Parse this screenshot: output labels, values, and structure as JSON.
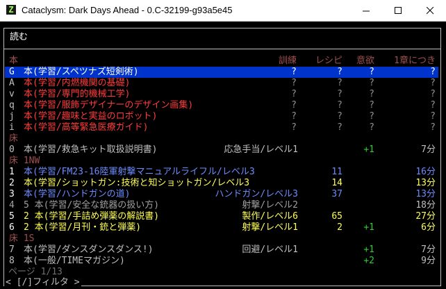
{
  "window": {
    "title": "Cataclysm: Dark Days Ahead - 0.C-32199-g93a5e45",
    "app_icon_glyph": "Z",
    "controls": [
      "minimize-icon",
      "maximize-icon",
      "close-icon"
    ]
  },
  "header": {
    "title": "読む"
  },
  "columns": {
    "section": "本",
    "train": "訓練",
    "recipe": "レシピ",
    "morale": "意欲",
    "per_chapter": "1章につき"
  },
  "groups": [
    {
      "label": "床"
    },
    {
      "label": "床 1NW"
    },
    {
      "label": "床 1S"
    }
  ],
  "rows": [
    {
      "key": "G",
      "name": "本(学習/スペツナズ短剣術)",
      "skill": "",
      "train": "?",
      "recipe": "?",
      "morale": "?",
      "time": "?",
      "color": "#ff3b3b",
      "key_color": "#ffffff",
      "highlight": true
    },
    {
      "key": "A",
      "name": "本(学習/内燃機関の基礎)",
      "skill": "",
      "train": "?",
      "recipe": "?",
      "morale": "?",
      "time": "?",
      "color": "#ff3b3b",
      "key_color": "#c0c0c0"
    },
    {
      "key": "v",
      "name": "本(学習/専門的機械工学)",
      "skill": "",
      "train": "?",
      "recipe": "?",
      "morale": "?",
      "time": "?",
      "color": "#ff3b3b",
      "key_color": "#c0c0c0"
    },
    {
      "key": "q",
      "name": "本(学習/服飾デザイナーのデザイン画集)",
      "skill": "",
      "train": "?",
      "recipe": "?",
      "morale": "?",
      "time": "?",
      "color": "#ff3b3b",
      "key_color": "#c0c0c0"
    },
    {
      "key": "j",
      "name": "本(学習/趣味と実益のロボット)",
      "skill": "",
      "train": "?",
      "recipe": "?",
      "morale": "?",
      "time": "?",
      "color": "#ff3b3b",
      "key_color": "#c0c0c0"
    },
    {
      "key": "i",
      "name": "本(学習/高等緊急医療ガイド)",
      "skill": "",
      "train": "?",
      "recipe": "?",
      "morale": "?",
      "time": "?",
      "color": "#ff3b3b",
      "key_color": "#c0c0c0"
    },
    {
      "key": "0",
      "name": "本(学習/救急キット取扱説明書)",
      "skill": "応急手当/レベル1",
      "train": "",
      "recipe": "",
      "morale": "+1",
      "time": "7分",
      "color": "#c0c0c0",
      "key_color": "#c0c0c0"
    },
    {
      "key": "1",
      "name": "本(学習/FM23-16陸軍射撃マニュアルライフル/レベル3",
      "skill": "",
      "train": "",
      "recipe": "11",
      "morale": "",
      "time": "16分",
      "color": "#6b8cff",
      "key_color": "#ffffff"
    },
    {
      "key": "2",
      "name": "本(学習/ショットガン:技術と知ショットガン/レベル3",
      "skill": "",
      "train": "",
      "recipe": "14",
      "morale": "",
      "time": "13分",
      "color": "#ffff55",
      "key_color": "#ffffff"
    },
    {
      "key": "3",
      "name": "本(学習/ハンドガンの道)",
      "skill": "ハンドガン/レベル3",
      "train": "",
      "recipe": "37",
      "morale": "",
      "time": "13分",
      "color": "#6b8cff",
      "key_color": "#ffffff"
    },
    {
      "key": "4",
      "name": "5 本(学習/安全な銃器の扱い方)",
      "skill": "射撃/レベル2",
      "train": "",
      "recipe": "",
      "morale": "",
      "time": "18分",
      "color": "#a0a0a0",
      "key_color": "#a0a0a0"
    },
    {
      "key": "5",
      "name": "2 本(学習/手詰め弾薬の解説書)",
      "skill": "製作/レベル6",
      "train": "",
      "recipe": "65",
      "morale": "",
      "time": "27分",
      "color": "#ffff55",
      "key_color": "#ffffff"
    },
    {
      "key": "6",
      "name": "2 本(学習/月刊・銃と弾薬)",
      "skill": "射撃/レベル1",
      "train": "",
      "recipe": "2",
      "morale": "+1",
      "time": "6分",
      "color": "#ffff55",
      "key_color": "#ffffff"
    },
    {
      "key": "7",
      "name": "本(学習/ダンスダンスダンス!)",
      "skill": "回避/レベル1",
      "train": "",
      "recipe": "",
      "morale": "+1",
      "time": "7分",
      "color": "#c0c0c0",
      "key_color": "#c0c0c0"
    },
    {
      "key": "8",
      "name": "本(一般/TIMEマガジン)",
      "skill": "",
      "train": "",
      "recipe": "",
      "morale": "+2",
      "time": "9分",
      "color": "#c0c0c0",
      "key_color": "#c0c0c0"
    }
  ],
  "footer": {
    "page": "ページ 1/13",
    "filter": "< [/]フィルタ >"
  },
  "colors": {
    "red": "#ff3b3b",
    "gray": "#c0c0c0",
    "dark_red": "#a05050",
    "green": "#33cc33",
    "yellow": "#ffff55",
    "blue": "#6b8cff",
    "highlight": "#0033cc"
  }
}
